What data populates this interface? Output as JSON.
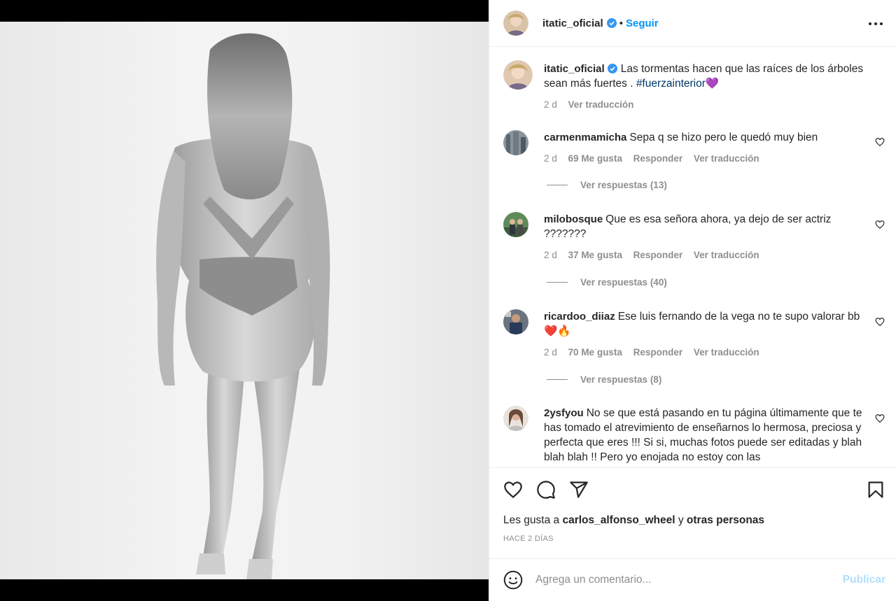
{
  "post": {
    "author": "itatic_oficial",
    "follow_label": "Seguir",
    "caption_text": "Las tormentas hacen que las raíces de los árboles sean más fuertes . ",
    "caption_hashtag": "#fuerzainterior",
    "caption_emoji": "💜",
    "caption_time": "2 d",
    "caption_translate": "Ver traducción"
  },
  "comments": [
    {
      "user": "carmenmamicha",
      "text": "Sepa q se hizo pero le quedó muy bien",
      "time": "2 d",
      "likes": "69 Me gusta",
      "reply": "Responder",
      "translate": "Ver traducción",
      "replies": "Ver respuestas (13)"
    },
    {
      "user": "milobosque",
      "text": "Que es esa señora ahora, ya dejo de ser actriz ???????",
      "time": "2 d",
      "likes": "37 Me gusta",
      "reply": "Responder",
      "translate": "Ver traducción",
      "replies": "Ver respuestas (40)"
    },
    {
      "user": "ricardoo_diiaz",
      "text": "Ese luis fernando de la vega no te supo valorar bb ❤️🔥",
      "time": "2 d",
      "likes": "70 Me gusta",
      "reply": "Responder",
      "translate": "Ver traducción",
      "replies": "Ver respuestas (8)"
    },
    {
      "user": "2ysfyou",
      "text": "No se que está pasando en tu página últimamente que te has tomado el atrevimiento de enseñarnos lo hermosa, preciosa y perfecta que eres !!! Si si, muchas fotos puede ser editadas y blah blah blah !! Pero yo enojada no estoy con las"
    }
  ],
  "likes_line": {
    "prefix": "Les gusta a ",
    "user": "carlos_alfonso_wheel",
    "middle": " y ",
    "others": "otras personas"
  },
  "posted_ago": "HACE 2 DÍAS",
  "comment_box": {
    "placeholder": "Agrega un comentario...",
    "publish_label": "Publicar"
  },
  "colors": {
    "accent": "#0095f6",
    "hashtag": "#00376b",
    "muted": "#8e8e8e",
    "publish_disabled": "#b2dffc"
  },
  "icons": [
    "verified-badge-icon",
    "more-options-icon",
    "heart-icon",
    "comment-icon",
    "share-icon",
    "bookmark-icon",
    "emoji-icon"
  ]
}
